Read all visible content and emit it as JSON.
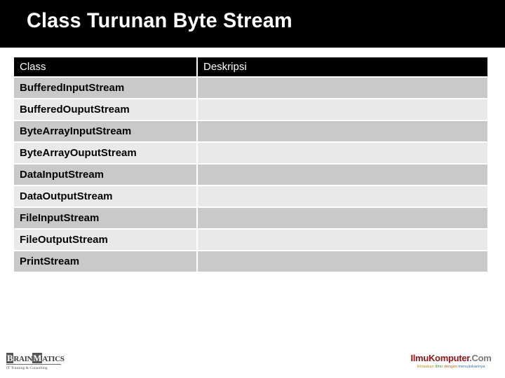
{
  "slide": {
    "title": "Class Turunan Byte Stream"
  },
  "table": {
    "headers": {
      "class": "Class",
      "description": "Deskripsi"
    },
    "rows": [
      {
        "class": "BufferedInputStream",
        "description": ""
      },
      {
        "class": "BufferedOuputStream",
        "description": ""
      },
      {
        "class": "ByteArrayInputStream",
        "description": ""
      },
      {
        "class": "ByteArrayOuputStream",
        "description": ""
      },
      {
        "class": "DataInputStream",
        "description": ""
      },
      {
        "class": "DataOutputStream",
        "description": ""
      },
      {
        "class": "FileInputStream",
        "description": ""
      },
      {
        "class": "FileOutputStream",
        "description": ""
      },
      {
        "class": "PrintStream",
        "description": ""
      }
    ]
  },
  "footer": {
    "brainmatics": {
      "word_b": "B",
      "word_rain": "RAIN",
      "word_m": "M",
      "word_atics": "ATICS",
      "tagline": "IT Training & Consulting"
    },
    "ilmukomputer": {
      "name": "IlmuKomputer",
      "domain": ".Com",
      "tagline_1": "Ikhlaskan",
      "tagline_2": "Ilmu",
      "tagline_3": "dengan",
      "tagline_4": "menuliskannya"
    }
  },
  "colors": {
    "band": "#000000",
    "row_odd": "#c9c9c9",
    "row_even": "#e9e9e9",
    "brand_red": "#8c1616"
  }
}
